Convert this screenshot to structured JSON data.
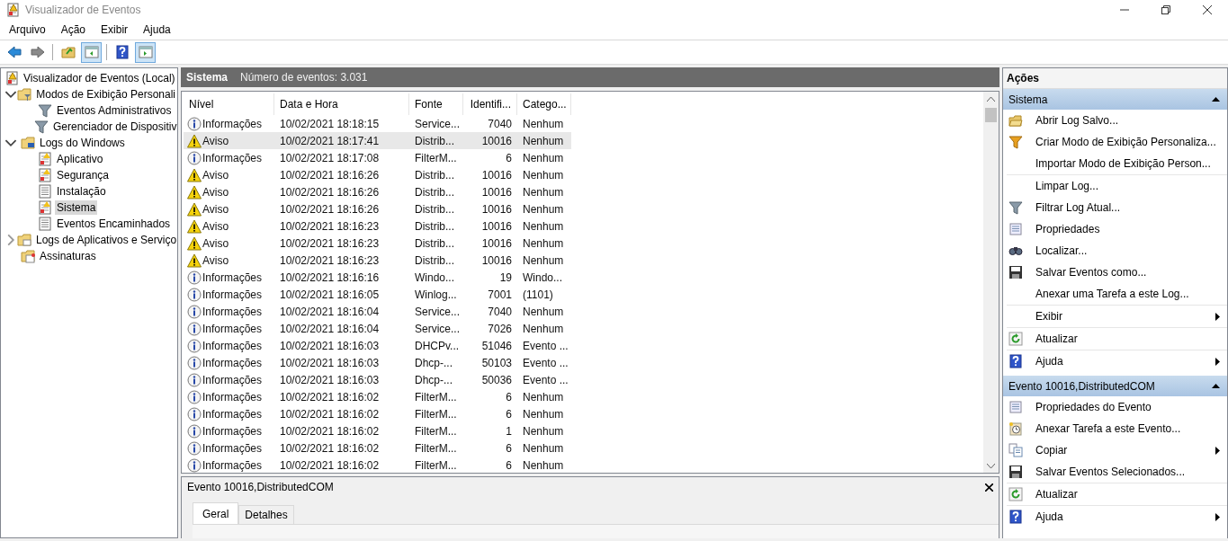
{
  "window": {
    "title": "Visualizador de Eventos"
  },
  "menu": [
    "Arquivo",
    "Ação",
    "Exibir",
    "Ajuda"
  ],
  "toolbar": [
    {
      "kind": "back",
      "pressed": false
    },
    {
      "kind": "forward",
      "pressed": false
    },
    {
      "kind": "sep"
    },
    {
      "kind": "up",
      "pressed": false
    },
    {
      "kind": "tree",
      "pressed": true
    },
    {
      "kind": "sep"
    },
    {
      "kind": "help",
      "pressed": false
    },
    {
      "kind": "actions",
      "pressed": true
    }
  ],
  "tree": [
    {
      "label": "Visualizador de Eventos (Local)",
      "kind": "root",
      "selected": false,
      "children": [
        {
          "label": "Modos de Exibição Personali",
          "kind": "folder-filter",
          "expanded": true,
          "selected": false,
          "children": [
            {
              "label": "Eventos Administrativos",
              "kind": "filter",
              "selected": false
            },
            {
              "label": "Gerenciador de Dispositiv",
              "kind": "filter",
              "selected": false
            }
          ]
        },
        {
          "label": "Logs do Windows",
          "kind": "folder-pc",
          "expanded": true,
          "selected": false,
          "children": [
            {
              "label": "Aplicativo",
              "kind": "log-alert",
              "selected": false
            },
            {
              "label": "Segurança",
              "kind": "log-alert",
              "selected": false
            },
            {
              "label": "Instalação",
              "kind": "log",
              "selected": false
            },
            {
              "label": "Sistema",
              "kind": "log-alert",
              "selected": true
            },
            {
              "label": "Eventos Encaminhados",
              "kind": "log",
              "selected": false
            }
          ]
        },
        {
          "label": "Logs de Aplicativos e Serviço",
          "kind": "folder",
          "expanded": false,
          "selected": false
        },
        {
          "label": "Assinaturas",
          "kind": "folder-sub",
          "selected": false
        }
      ]
    }
  ],
  "log_header": {
    "name": "Sistema",
    "count": "Número de eventos: 3.031"
  },
  "table": {
    "columns": [
      "Nível",
      "Data e Hora",
      "Fonte",
      "Identifi...",
      "Catego..."
    ],
    "rows": [
      {
        "kind": "info",
        "level": "Informações",
        "date": "10/02/2021 18:18:15",
        "source": "Service...",
        "id": "7040",
        "category": "Nenhum",
        "selected": false
      },
      {
        "kind": "warning",
        "level": "Aviso",
        "date": "10/02/2021 18:17:41",
        "source": "Distrib...",
        "id": "10016",
        "category": "Nenhum",
        "selected": true
      },
      {
        "kind": "info",
        "level": "Informações",
        "date": "10/02/2021 18:17:08",
        "source": "FilterM...",
        "id": "6",
        "category": "Nenhum",
        "selected": false
      },
      {
        "kind": "warning",
        "level": "Aviso",
        "date": "10/02/2021 18:16:26",
        "source": "Distrib...",
        "id": "10016",
        "category": "Nenhum",
        "selected": false
      },
      {
        "kind": "warning",
        "level": "Aviso",
        "date": "10/02/2021 18:16:26",
        "source": "Distrib...",
        "id": "10016",
        "category": "Nenhum",
        "selected": false
      },
      {
        "kind": "warning",
        "level": "Aviso",
        "date": "10/02/2021 18:16:26",
        "source": "Distrib...",
        "id": "10016",
        "category": "Nenhum",
        "selected": false
      },
      {
        "kind": "warning",
        "level": "Aviso",
        "date": "10/02/2021 18:16:23",
        "source": "Distrib...",
        "id": "10016",
        "category": "Nenhum",
        "selected": false
      },
      {
        "kind": "warning",
        "level": "Aviso",
        "date": "10/02/2021 18:16:23",
        "source": "Distrib...",
        "id": "10016",
        "category": "Nenhum",
        "selected": false
      },
      {
        "kind": "warning",
        "level": "Aviso",
        "date": "10/02/2021 18:16:23",
        "source": "Distrib...",
        "id": "10016",
        "category": "Nenhum",
        "selected": false
      },
      {
        "kind": "info",
        "level": "Informações",
        "date": "10/02/2021 18:16:16",
        "source": "Windo...",
        "id": "19",
        "category": "Windo...",
        "selected": false
      },
      {
        "kind": "info",
        "level": "Informações",
        "date": "10/02/2021 18:16:05",
        "source": "Winlog...",
        "id": "7001",
        "category": "(1101)",
        "selected": false
      },
      {
        "kind": "info",
        "level": "Informações",
        "date": "10/02/2021 18:16:04",
        "source": "Service...",
        "id": "7040",
        "category": "Nenhum",
        "selected": false
      },
      {
        "kind": "info",
        "level": "Informações",
        "date": "10/02/2021 18:16:04",
        "source": "Service...",
        "id": "7026",
        "category": "Nenhum",
        "selected": false
      },
      {
        "kind": "info",
        "level": "Informações",
        "date": "10/02/2021 18:16:03",
        "source": "DHCPv...",
        "id": "51046",
        "category": "Evento ...",
        "selected": false
      },
      {
        "kind": "info",
        "level": "Informações",
        "date": "10/02/2021 18:16:03",
        "source": "Dhcp-...",
        "id": "50103",
        "category": "Evento ...",
        "selected": false
      },
      {
        "kind": "info",
        "level": "Informações",
        "date": "10/02/2021 18:16:03",
        "source": "Dhcp-...",
        "id": "50036",
        "category": "Evento ...",
        "selected": false
      },
      {
        "kind": "info",
        "level": "Informações",
        "date": "10/02/2021 18:16:02",
        "source": "FilterM...",
        "id": "6",
        "category": "Nenhum",
        "selected": false
      },
      {
        "kind": "info",
        "level": "Informações",
        "date": "10/02/2021 18:16:02",
        "source": "FilterM...",
        "id": "6",
        "category": "Nenhum",
        "selected": false
      },
      {
        "kind": "info",
        "level": "Informações",
        "date": "10/02/2021 18:16:02",
        "source": "FilterM...",
        "id": "1",
        "category": "Nenhum",
        "selected": false
      },
      {
        "kind": "info",
        "level": "Informações",
        "date": "10/02/2021 18:16:02",
        "source": "FilterM...",
        "id": "6",
        "category": "Nenhum",
        "selected": false
      },
      {
        "kind": "info",
        "level": "Informações",
        "date": "10/02/2021 18:16:02",
        "source": "FilterM...",
        "id": "6",
        "category": "Nenhum",
        "selected": false
      }
    ]
  },
  "detail": {
    "title": "Evento 10016,DistributedCOM",
    "tabs": [
      {
        "label": "Geral",
        "selected": true
      },
      {
        "label": "Detalhes",
        "selected": false
      }
    ]
  },
  "actions": {
    "title": "Ações",
    "sections": [
      {
        "title": "Sistema",
        "expanded": true,
        "items": [
          {
            "label": "Abrir Log Salvo...",
            "kind": "open",
            "submenu": false,
            "separator_after": false
          },
          {
            "label": "Criar Modo de Exibição Personaliza...",
            "kind": "filter-new",
            "submenu": false,
            "separator_after": false
          },
          {
            "label": "Importar Modo de Exibição Person...",
            "kind": "none",
            "submenu": false,
            "separator_after": true
          },
          {
            "label": "Limpar Log...",
            "kind": "none",
            "submenu": false,
            "separator_after": false
          },
          {
            "label": "Filtrar Log Atual...",
            "kind": "filter",
            "submenu": false,
            "separator_after": false
          },
          {
            "label": "Propriedades",
            "kind": "properties",
            "submenu": false,
            "separator_after": false
          },
          {
            "label": "Localizar...",
            "kind": "find",
            "submenu": false,
            "separator_after": false
          },
          {
            "label": "Salvar Eventos como...",
            "kind": "save",
            "submenu": false,
            "separator_after": false
          },
          {
            "label": "Anexar uma Tarefa a este Log...",
            "kind": "none",
            "submenu": false,
            "separator_after": true
          },
          {
            "label": "Exibir",
            "kind": "none",
            "submenu": true,
            "separator_after": true
          },
          {
            "label": "Atualizar",
            "kind": "refresh",
            "submenu": false,
            "separator_after": true
          },
          {
            "label": "Ajuda",
            "kind": "help",
            "submenu": true,
            "separator_after": false
          }
        ]
      },
      {
        "title": "Evento 10016,DistributedCOM",
        "expanded": true,
        "items": [
          {
            "label": "Propriedades do Evento",
            "kind": "properties",
            "submenu": false,
            "separator_after": false
          },
          {
            "label": "Anexar Tarefa a este Evento...",
            "kind": "task",
            "submenu": false,
            "separator_after": false
          },
          {
            "label": "Copiar",
            "kind": "copy",
            "submenu": true,
            "separator_after": false
          },
          {
            "label": "Salvar Eventos Selecionados...",
            "kind": "save",
            "submenu": false,
            "separator_after": true
          },
          {
            "label": "Atualizar",
            "kind": "refresh",
            "submenu": false,
            "separator_after": true
          },
          {
            "label": "Ajuda",
            "kind": "help",
            "submenu": true,
            "separator_after": false
          }
        ]
      }
    ]
  }
}
